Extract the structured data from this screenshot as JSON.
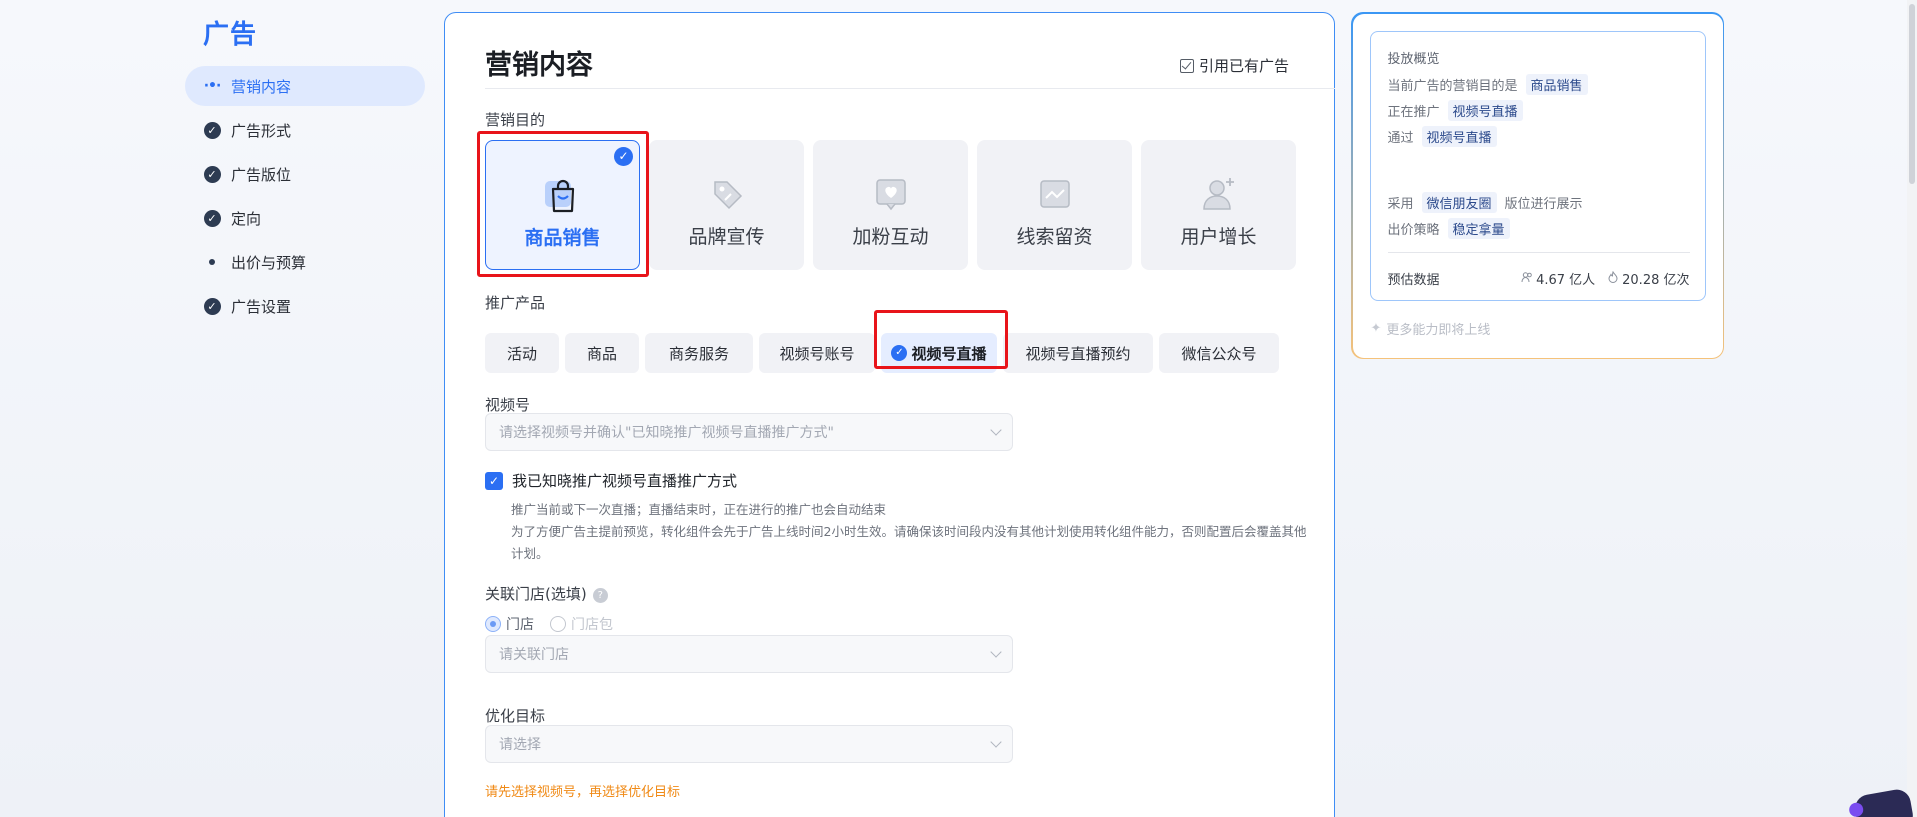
{
  "nav": {
    "title": "广告",
    "items": [
      {
        "label": "营销内容",
        "state": "active"
      },
      {
        "label": "广告形式",
        "state": "done"
      },
      {
        "label": "广告版位",
        "state": "done"
      },
      {
        "label": "定向",
        "state": "done"
      },
      {
        "label": "出价与预算",
        "state": "pending"
      },
      {
        "label": "广告设置",
        "state": "done"
      }
    ]
  },
  "main": {
    "title": "营销内容",
    "reference_link": "引用已有广告",
    "purpose": {
      "label": "营销目的",
      "options": [
        {
          "label": "商品销售",
          "icon": "shopping-bag-icon",
          "selected": true
        },
        {
          "label": "品牌宣传",
          "icon": "tag-icon",
          "selected": false
        },
        {
          "label": "加粉互动",
          "icon": "heart-chat-icon",
          "selected": false
        },
        {
          "label": "线索留资",
          "icon": "chart-lead-icon",
          "selected": false
        },
        {
          "label": "用户增长",
          "icon": "user-add-icon",
          "selected": false
        }
      ]
    },
    "product": {
      "label": "推广产品",
      "options": [
        {
          "label": "活动",
          "selected": false
        },
        {
          "label": "商品",
          "selected": false
        },
        {
          "label": "商务服务",
          "selected": false
        },
        {
          "label": "视频号账号",
          "selected": false
        },
        {
          "label": "视频号直播",
          "selected": true
        },
        {
          "label": "视频号直播预约",
          "selected": false
        },
        {
          "label": "微信公众号",
          "selected": false
        }
      ]
    },
    "channel": {
      "label": "视频号",
      "placeholder": "请选择视频号并确认\"已知晓推广视频号直播推广方式\""
    },
    "confirm": {
      "label": "我已知晓推广视频号直播推广方式",
      "checked": true,
      "notes": [
        "推广当前或下一次直播；直播结束时，正在进行的推广也会自动结束",
        "为了方便广告主提前预览，转化组件会先于广告上线时间2小时生效。请确保该时间段内没有其他计划使用转化组件能力，否则配置后会覆盖其他计划。"
      ]
    },
    "store": {
      "label": "关联门店(选填)",
      "radio_options": [
        {
          "label": "门店",
          "selected": true
        },
        {
          "label": "门店包",
          "selected": false
        }
      ],
      "placeholder": "请关联门店"
    },
    "optimize": {
      "label": "优化目标",
      "placeholder": "请选择",
      "warning": "请先选择视频号，再选择优化目标"
    }
  },
  "overview": {
    "title": "投放概览",
    "line1_prefix": "当前广告的营销目的是",
    "line1_tag": "商品销售",
    "line2_prefix": "正在推广",
    "line2_tag": "视频号直播",
    "line3_prefix": "通过",
    "line3_tag": "视频号直播",
    "line4_prefix": "采用",
    "line4_tag": "微信朋友圈",
    "line4_suffix": "版位进行展示",
    "line5_prefix": "出价策略",
    "line5_tag": "稳定拿量",
    "estimate_label": "预估数据",
    "estimate_people": "4.67 亿人",
    "estimate_times": "20.28 亿次",
    "more": "更多能力即将上线"
  },
  "colors": {
    "accent": "#2b6ff3",
    "highlight_box": "#e8141a",
    "warning": "#f08a16"
  }
}
